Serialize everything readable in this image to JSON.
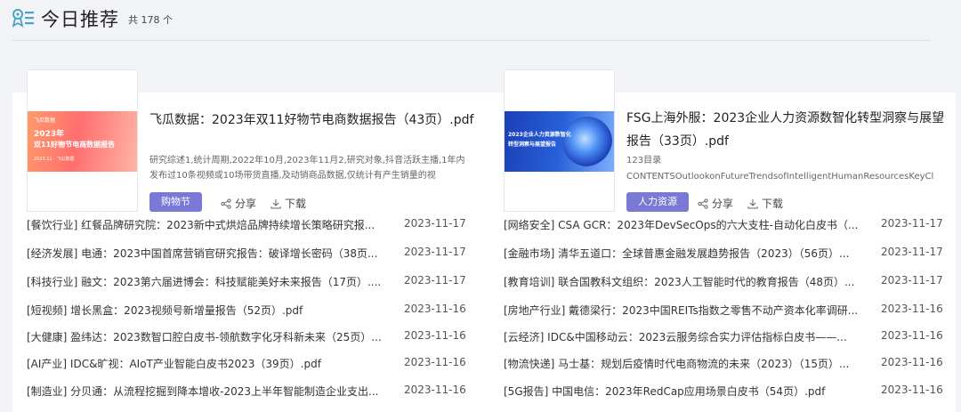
{
  "header": {
    "title": "今日推荐",
    "count": "共 178 个",
    "icon": "recommend-list-icon",
    "accent": "#4aa3c5"
  },
  "featured": [
    {
      "cover_brand": "飞瓜数据",
      "cover_title_1": "2023年",
      "cover_title_2": "双11好物节电商数据报告",
      "cover_sub": "2023.11 · 飞瓜数据",
      "title": "飞瓜数据：2023年双11好物节电商数据报告（43页）.pdf",
      "desc": "研究综述1,统计周期,2022年10月,2023年11月2,研究对象,抖音活跃主播,1年内发布过10条视频或10场带货直播,及动销商品数据,仅统计有产生销量的视",
      "tag": "购物节",
      "share": "分享",
      "download": "下载"
    },
    {
      "cover_title_1": "2023企业人力资源数智化",
      "cover_title_2": "转型洞察与展望报告",
      "title": "FSG上海外服：2023企业人力资源数智化转型洞察与展望报告（33页）.pdf",
      "desc_line1": "123目录",
      "desc_line2": "CONTENTSOutlookonFutureTrendsofIntelligentHumanResourcesKeyCl",
      "tag": "人力资源",
      "share": "分享",
      "download": "下载"
    }
  ],
  "left_list": [
    {
      "title": "[餐饮行业] 红餐品牌研究院：2023新中式烘焙品牌持续增长策略研究报...",
      "date": "2023-11-17"
    },
    {
      "title": "[经济发展] 电通：2023中国首席营销官研究报告：破译增长密码（38页...",
      "date": "2023-11-17"
    },
    {
      "title": "[科技行业] 融文：2023第六届进博会：科技赋能美好未来报告（17页）....",
      "date": "2023-11-17"
    },
    {
      "title": "[短视频] 增长黑盒：2023视频号新增量报告（52页）.pdf",
      "date": "2023-11-16"
    },
    {
      "title": "[大健康] 盈纬达：2023数智口腔白皮书-领航数字化牙科新未来（25页）...",
      "date": "2023-11-16"
    },
    {
      "title": "[AI产业] IDC&旷视：AIoT产业智能白皮书2023（39页）.pdf",
      "date": "2023-11-16"
    },
    {
      "title": "[制造业] 分贝通：从流程挖掘到降本增收-2023上半年智能制造企业支出...",
      "date": "2023-11-16"
    }
  ],
  "right_list": [
    {
      "title": "[网络安全] CSA GCR：2023年DevSecOps的六大支柱-自动化白皮书（...",
      "date": "2023-11-17"
    },
    {
      "title": "[金融市场] 清华五道口：全球普惠金融发展趋势报告（2023）（56页）...",
      "date": "2023-11-17"
    },
    {
      "title": "[教育培训] 联合国教科文组织：2023人工智能时代的教育报告（48页）...",
      "date": "2023-11-17"
    },
    {
      "title": "[房地产行业] 戴德梁行：2023中国REITs指数之零售不动产资本化率调研...",
      "date": "2023-11-16"
    },
    {
      "title": "[云经济] IDC&中国移动云：2023云服务综合实力评估指标白皮书——...",
      "date": "2023-11-16"
    },
    {
      "title": "[物流快递] 马士基：规划后疫情时代电商物流的未来（2023）（15页）...",
      "date": "2023-11-16"
    },
    {
      "title": "[5G报告] 中国电信：2023年RedCap应用场景白皮书（54页）.pdf",
      "date": "2023-11-16"
    }
  ]
}
